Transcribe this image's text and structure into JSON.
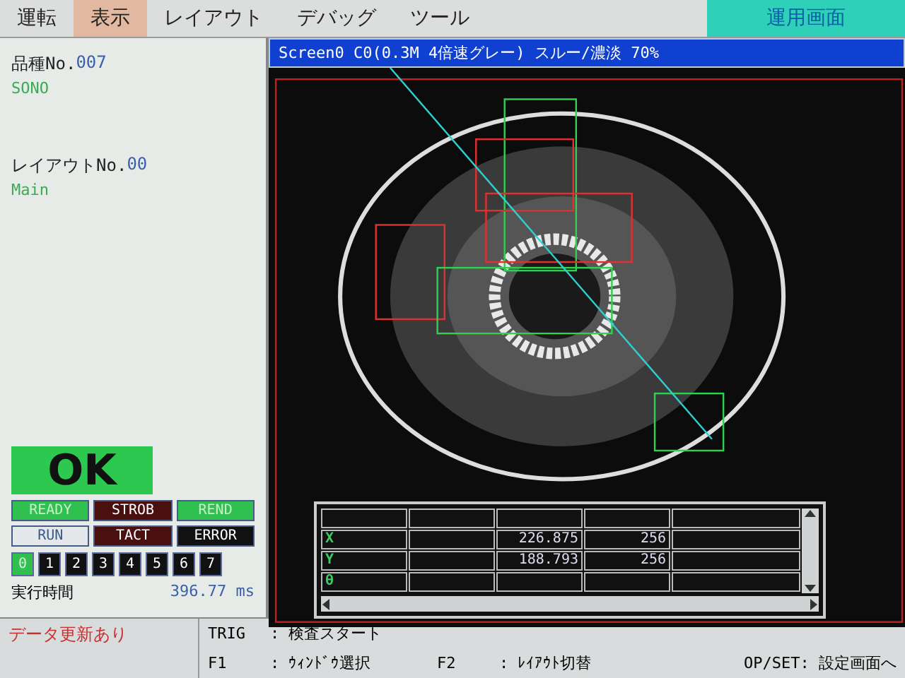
{
  "menu": {
    "items": [
      {
        "label": "運転",
        "selected": false
      },
      {
        "label": "表示",
        "selected": true
      },
      {
        "label": "レイアウト",
        "selected": false
      },
      {
        "label": "デバッグ",
        "selected": false
      },
      {
        "label": "ツール",
        "selected": false
      }
    ],
    "mode": "運用画面"
  },
  "info": {
    "product_label": "品種No.",
    "product_no": "007",
    "product_name": "SONO",
    "layout_label": "レイアウトNo.",
    "layout_no": "00",
    "layout_name": "Main"
  },
  "result": {
    "text": "OK",
    "kind": "ok"
  },
  "lamps": [
    {
      "label": "READY",
      "kind": "ok",
      "on": true
    },
    {
      "label": "STROB",
      "kind": "ng",
      "on": false
    },
    {
      "label": "REND",
      "kind": "ok",
      "on": true
    },
    {
      "label": "RUN",
      "kind": "ok",
      "on": false
    },
    {
      "label": "TACT",
      "kind": "ng",
      "on": false
    },
    {
      "label": "ERROR",
      "kind": "error",
      "on": false
    }
  ],
  "channels": [
    {
      "label": "0",
      "selected": true
    },
    {
      "label": "1",
      "selected": false
    },
    {
      "label": "2",
      "selected": false
    },
    {
      "label": "3",
      "selected": false
    },
    {
      "label": "4",
      "selected": false
    },
    {
      "label": "5",
      "selected": false
    },
    {
      "label": "6",
      "selected": false
    },
    {
      "label": "7",
      "selected": false
    }
  ],
  "exec_time": {
    "label": "実行時間",
    "value": "396.77",
    "unit": "ms"
  },
  "view": {
    "title": "Screen0 C0(0.3M 4倍速グレー) スルー/濃淡 70%"
  },
  "table": {
    "rows": [
      {
        "label": "X",
        "value": "226.875",
        "count": "256"
      },
      {
        "label": "Y",
        "value": "188.793",
        "count": "256"
      },
      {
        "label": "θ"
      }
    ]
  },
  "status_bar": {
    "notice": "データ更新あり",
    "rows": [
      [
        {
          "key": "TRIG",
          "action": ": 検査スタート"
        }
      ],
      [
        {
          "key": "F1",
          "action": ": ｳｨﾝﾄﾞｳ選択"
        },
        {
          "key": "F2",
          "action": ": ﾚｲｱｳﾄ切替"
        }
      ]
    ],
    "op": "OP/SET: 設定画面へ"
  }
}
